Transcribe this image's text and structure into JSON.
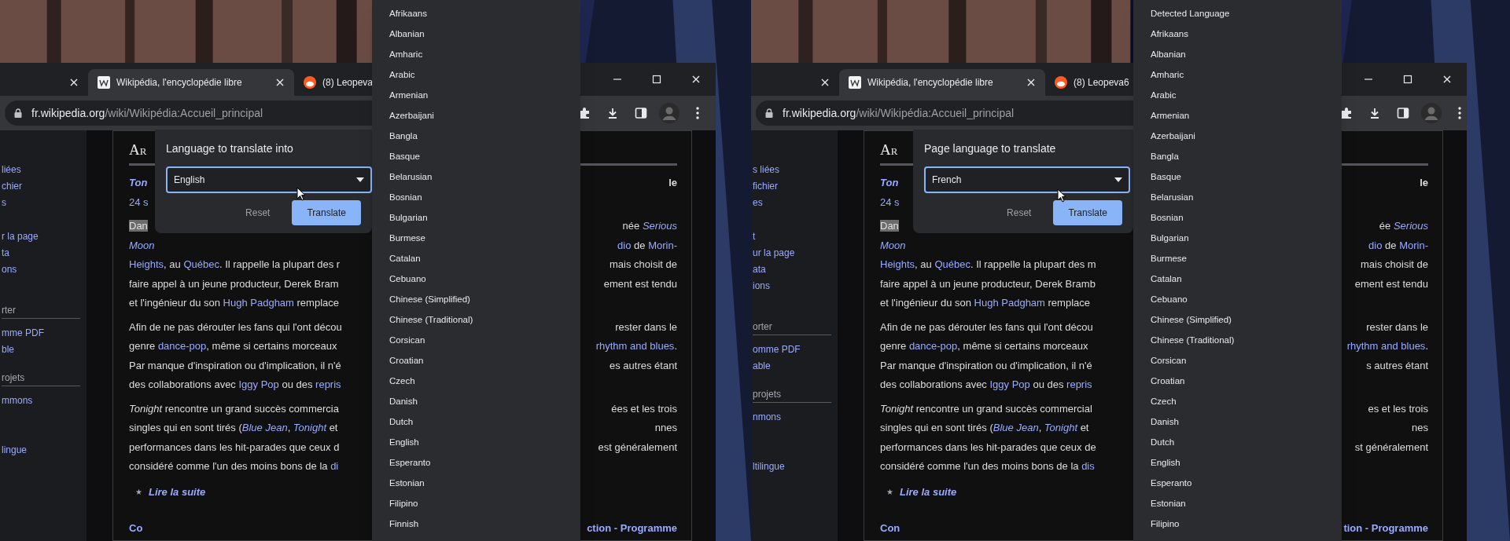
{
  "panels": [
    {
      "tabs": [
        {
          "selected": false
        },
        {
          "label": "Wikipédia, l'encyclopédie libre",
          "selected": true
        },
        {
          "label": "(8) Leopeva",
          "selected": false
        }
      ],
      "address": {
        "host": "fr.wikipedia.org",
        "path": "/wiki/Wikipédia:Accueil_principal"
      },
      "sidebar": [
        {
          "items": [
            "liées",
            "chier",
            "s"
          ]
        },
        {
          "items": [
            "r la page",
            "ta",
            "ons"
          ]
        },
        {
          "heading": "rter",
          "items": [
            "mme PDF",
            "ble"
          ]
        },
        {
          "heading": "rojets",
          "items": [
            "mmons"
          ]
        },
        {
          "items": [
            "lingue"
          ]
        }
      ],
      "article": {
        "heading": "Ar",
        "intro": [
          {
            "left": [
              {
                "text": "Ton",
                "kind": "title-link"
              }
            ],
            "right": [
              {
                "text": "le",
                "kind": "strong"
              }
            ]
          },
          {
            "left": [
              {
                "text": "24 s",
                "kind": "link"
              }
            ]
          }
        ],
        "paragraphs": [
          {
            "lines": [
              {
                "left": [
                  {
                    "text": "Dan",
                    "kind": "highlight"
                  }
                ],
                "right": [
                  {
                    "text": "née ",
                    "kind": "plain"
                  },
                  {
                    "text": "*Serious*",
                    "kind": "link"
                  }
                ]
              },
              {
                "left": [
                  {
                    "text": "*Moon*",
                    "kind": "link"
                  }
                ],
                "right": [
                  {
                    "text": "dio",
                    "kind": "link"
                  },
                  {
                    "text": " de ",
                    "kind": "plain"
                  },
                  {
                    "text": "Morin-",
                    "kind": "link"
                  }
                ]
              },
              {
                "left": [
                  {
                    "text": "Heights",
                    "kind": "link"
                  },
                  {
                    "text": ", au ",
                    "kind": "plain"
                  },
                  {
                    "text": "Québec",
                    "kind": "link"
                  },
                  {
                    "text": ". Il rappelle la plupart des r",
                    "kind": "plain"
                  }
                ],
                "right": [
                  {
                    "text": "mais choisit de",
                    "kind": "plain"
                  }
                ]
              },
              {
                "left": [
                  {
                    "text": "faire appel à un jeune producteur, Derek Bram",
                    "kind": "plain"
                  }
                ],
                "right": [
                  {
                    "text": "ement est tendu",
                    "kind": "plain"
                  }
                ]
              },
              {
                "left": [
                  {
                    "text": "et l'ingénieur du son ",
                    "kind": "plain"
                  },
                  {
                    "text": "Hugh Padgham",
                    "kind": "link"
                  },
                  {
                    "text": " remplace",
                    "kind": "plain"
                  }
                ]
              }
            ]
          },
          {
            "lines": [
              {
                "left": [
                  {
                    "text": "Afin de ne pas dérouter les fans qui l'ont décou",
                    "kind": "plain"
                  }
                ],
                "right": [
                  {
                    "text": "rester dans le",
                    "kind": "plain"
                  }
                ]
              },
              {
                "left": [
                  {
                    "text": "genre ",
                    "kind": "plain"
                  },
                  {
                    "text": "dance-pop",
                    "kind": "link"
                  },
                  {
                    "text": ", même si certains morceaux",
                    "kind": "plain"
                  }
                ],
                "right": [
                  {
                    "text": "rhythm and blues",
                    "kind": "link"
                  },
                  {
                    "text": ".",
                    "kind": "plain"
                  }
                ]
              },
              {
                "left": [
                  {
                    "text": "Par manque d'inspiration ou d'implication, il n'é",
                    "kind": "plain"
                  }
                ],
                "right": [
                  {
                    "text": "es autres étant",
                    "kind": "plain"
                  }
                ]
              },
              {
                "left": [
                  {
                    "text": "des collaborations avec ",
                    "kind": "plain"
                  },
                  {
                    "text": "Iggy Pop",
                    "kind": "link"
                  },
                  {
                    "text": " ou des ",
                    "kind": "plain"
                  },
                  {
                    "text": "repris",
                    "kind": "link"
                  }
                ]
              }
            ]
          },
          {
            "lines": [
              {
                "left": [
                  {
                    "text": "*Tonight* rencontre un grand succès commercia",
                    "kind": "plain"
                  }
                ],
                "right": [
                  {
                    "text": "ées et les trois",
                    "kind": "plain"
                  }
                ]
              },
              {
                "left": [
                  {
                    "text": "singles qui en sont tirés (",
                    "kind": "plain"
                  },
                  {
                    "text": "*Blue Jean*",
                    "kind": "link"
                  },
                  {
                    "text": ", ",
                    "kind": "plain"
                  },
                  {
                    "text": "*Tonight*",
                    "kind": "link"
                  },
                  {
                    "text": " et",
                    "kind": "plain"
                  }
                ],
                "right": [
                  {
                    "text": "nnes",
                    "kind": "plain"
                  }
                ]
              },
              {
                "left": [
                  {
                    "text": "performances dans les hit-parades que ceux d",
                    "kind": "plain"
                  }
                ],
                "right": [
                  {
                    "text": "est généralement",
                    "kind": "plain"
                  }
                ]
              },
              {
                "left": [
                  {
                    "text": "considéré comme l'un des moins bons de la ",
                    "kind": "plain"
                  },
                  {
                    "text": "di",
                    "kind": "link"
                  }
                ]
              }
            ]
          }
        ],
        "more": {
          "star": "★",
          "text": "Lire la suite"
        },
        "footer": {
          "left": [
            {
              "text": "Co",
              "kind": "bold-link"
            }
          ],
          "right": [
            {
              "text": "ction - Programme",
              "kind": "bold-link"
            }
          ]
        }
      },
      "popup": {
        "title": "Language to translate into",
        "value": "English",
        "buttons": [
          {
            "label": "Reset",
            "kind": "secondary"
          },
          {
            "label": "Translate",
            "kind": "primary"
          }
        ]
      },
      "dropdown": {
        "options": [
          "Afrikaans",
          "Albanian",
          "Amharic",
          "Arabic",
          "Armenian",
          "Azerbaijani",
          "Bangla",
          "Basque",
          "Belarusian",
          "Bosnian",
          "Bulgarian",
          "Burmese",
          "Catalan",
          "Cebuano",
          "Chinese (Simplified)",
          "Chinese (Traditional)",
          "Corsican",
          "Croatian",
          "Czech",
          "Danish",
          "Dutch",
          "English",
          "Esperanto",
          "Estonian",
          "Filipino",
          "Finnish"
        ]
      }
    },
    {
      "tabs": [
        {
          "selected": false
        },
        {
          "label": "Wikipédia, l'encyclopédie libre",
          "selected": true
        },
        {
          "label": "(8) Leopeva6",
          "selected": false
        }
      ],
      "address": {
        "host": "fr.wikipedia.org",
        "path": "/wiki/Wikipédia:Accueil_principal"
      },
      "sidebar": [
        {
          "items": [
            "s liées",
            "fichier",
            "es"
          ]
        },
        {
          "items": [
            "t",
            "ur la page",
            "ata",
            "ions"
          ]
        },
        {
          "heading": "orter",
          "items": [
            "omme PDF",
            "able"
          ]
        },
        {
          "heading": "projets",
          "items": [
            "nmons"
          ]
        },
        {
          "items": [
            "ltilingue"
          ]
        }
      ],
      "article": {
        "heading": "Ar",
        "intro": [
          {
            "left": [
              {
                "text": "Ton",
                "kind": "title-link"
              }
            ],
            "right": [
              {
                "text": "le",
                "kind": "strong"
              }
            ]
          },
          {
            "left": [
              {
                "text": "24 s",
                "kind": "link"
              }
            ]
          }
        ],
        "paragraphs": [
          {
            "lines": [
              {
                "left": [
                  {
                    "text": "Dan",
                    "kind": "highlight"
                  }
                ],
                "right": [
                  {
                    "text": "ée ",
                    "kind": "plain"
                  },
                  {
                    "text": "*Serious*",
                    "kind": "link"
                  }
                ]
              },
              {
                "left": [
                  {
                    "text": "*Moon*",
                    "kind": "link"
                  }
                ],
                "right": [
                  {
                    "text": "dio",
                    "kind": "link"
                  },
                  {
                    "text": " de ",
                    "kind": "plain"
                  },
                  {
                    "text": "Morin-",
                    "kind": "link"
                  }
                ]
              },
              {
                "left": [
                  {
                    "text": "Heights",
                    "kind": "link"
                  },
                  {
                    "text": ", au ",
                    "kind": "plain"
                  },
                  {
                    "text": "Québec",
                    "kind": "link"
                  },
                  {
                    "text": ". Il rappelle la plupart des m",
                    "kind": "plain"
                  }
                ],
                "right": [
                  {
                    "text": "mais choisit de",
                    "kind": "plain"
                  }
                ]
              },
              {
                "left": [
                  {
                    "text": "faire appel à un jeune producteur, Derek Bramb",
                    "kind": "plain"
                  }
                ],
                "right": [
                  {
                    "text": "ement est tendu",
                    "kind": "plain"
                  }
                ]
              },
              {
                "left": [
                  {
                    "text": "et l'ingénieur du son ",
                    "kind": "plain"
                  },
                  {
                    "text": "Hugh Padgham",
                    "kind": "link"
                  },
                  {
                    "text": " remplace",
                    "kind": "plain"
                  }
                ]
              }
            ]
          },
          {
            "lines": [
              {
                "left": [
                  {
                    "text": "Afin de ne pas dérouter les fans qui l'ont décou",
                    "kind": "plain"
                  }
                ],
                "right": [
                  {
                    "text": "rester dans le",
                    "kind": "plain"
                  }
                ]
              },
              {
                "left": [
                  {
                    "text": "genre ",
                    "kind": "plain"
                  },
                  {
                    "text": "dance-pop",
                    "kind": "link"
                  },
                  {
                    "text": ", même si certains morceaux",
                    "kind": "plain"
                  }
                ],
                "right": [
                  {
                    "text": "rhythm and blues",
                    "kind": "link"
                  },
                  {
                    "text": ".",
                    "kind": "plain"
                  }
                ]
              },
              {
                "left": [
                  {
                    "text": "Par manque d'inspiration ou d'implication, il n'é",
                    "kind": "plain"
                  }
                ],
                "right": [
                  {
                    "text": "s autres étant",
                    "kind": "plain"
                  }
                ]
              },
              {
                "left": [
                  {
                    "text": "des collaborations avec ",
                    "kind": "plain"
                  },
                  {
                    "text": "Iggy Pop",
                    "kind": "link"
                  },
                  {
                    "text": " ou des ",
                    "kind": "plain"
                  },
                  {
                    "text": "repris",
                    "kind": "link"
                  }
                ]
              }
            ]
          },
          {
            "lines": [
              {
                "left": [
                  {
                    "text": "*Tonight* rencontre un grand succès commercial",
                    "kind": "plain"
                  }
                ],
                "right": [
                  {
                    "text": "es et les trois",
                    "kind": "plain"
                  }
                ]
              },
              {
                "left": [
                  {
                    "text": "singles qui en sont tirés (",
                    "kind": "plain"
                  },
                  {
                    "text": "*Blue Jean*",
                    "kind": "link"
                  },
                  {
                    "text": ", ",
                    "kind": "plain"
                  },
                  {
                    "text": "*Tonight*",
                    "kind": "link"
                  },
                  {
                    "text": " et",
                    "kind": "plain"
                  }
                ],
                "right": [
                  {
                    "text": "nes",
                    "kind": "plain"
                  }
                ]
              },
              {
                "left": [
                  {
                    "text": "performances dans les hit-parades que ceux de",
                    "kind": "plain"
                  }
                ],
                "right": [
                  {
                    "text": "st généralement",
                    "kind": "plain"
                  }
                ]
              },
              {
                "left": [
                  {
                    "text": "considéré comme l'un des moins bons de la ",
                    "kind": "plain"
                  },
                  {
                    "text": "dis",
                    "kind": "link"
                  }
                ]
              }
            ]
          }
        ],
        "more": {
          "star": "★",
          "text": "Lire la suite"
        },
        "footer": {
          "left": [
            {
              "text": "Con",
              "kind": "bold-link"
            }
          ],
          "right": [
            {
              "text": "tion - Programme",
              "kind": "bold-link"
            }
          ]
        }
      },
      "popup": {
        "title": "Page language to translate",
        "value": "French",
        "buttons": [
          {
            "label": "Reset",
            "kind": "secondary"
          },
          {
            "label": "Translate",
            "kind": "primary"
          }
        ]
      },
      "dropdown": {
        "options": [
          "Detected Language",
          "Afrikaans",
          "Albanian",
          "Amharic",
          "Arabic",
          "Armenian",
          "Azerbaijani",
          "Bangla",
          "Basque",
          "Belarusian",
          "Bosnian",
          "Bulgarian",
          "Burmese",
          "Catalan",
          "Cebuano",
          "Chinese (Simplified)",
          "Chinese (Traditional)",
          "Corsican",
          "Croatian",
          "Czech",
          "Danish",
          "Dutch",
          "English",
          "Esperanto",
          "Estonian",
          "Filipino"
        ]
      }
    }
  ]
}
